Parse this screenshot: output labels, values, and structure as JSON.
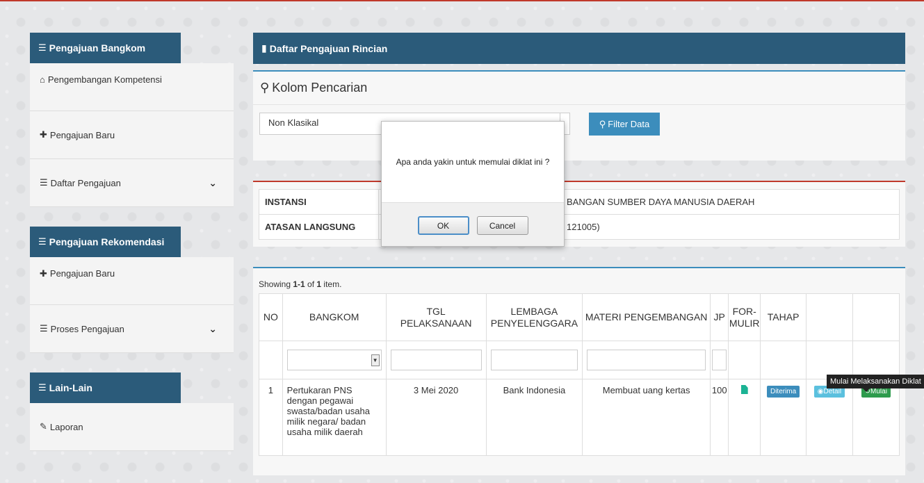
{
  "sidebar": {
    "section1": {
      "title": "Pengajuan Bangkom",
      "items": [
        {
          "label": "Pengembangan Kompetensi",
          "icon": "home-icon"
        },
        {
          "label": "Pengajuan Baru",
          "icon": "plus-icon"
        },
        {
          "label": "Daftar Pengajuan",
          "icon": "list-icon"
        }
      ]
    },
    "section2": {
      "title": "Pengajuan Rekomendasi",
      "items": [
        {
          "label": "Pengajuan Baru",
          "icon": "plus-icon"
        },
        {
          "label": "Proses Pengajuan",
          "icon": "list-icon"
        }
      ]
    },
    "section3": {
      "title": "Lain-Lain",
      "items": [
        {
          "label": "Laporan",
          "icon": "edit-icon"
        }
      ]
    }
  },
  "main": {
    "header": "Daftar Pengajuan Rincian",
    "search": {
      "title": "Kolom Pencarian",
      "select_value": "Non Klasikal",
      "filter_label": "Filter Data"
    },
    "info": {
      "instansi_label": "INSTANSI",
      "instansi_value": "BANGAN SUMBER DAYA MANUSIA DAERAH",
      "atasan_label": "ATASAN LANGSUNG",
      "atasan_value": "121005)"
    },
    "table": {
      "summary_prefix": "Showing ",
      "summary_range": "1-1",
      "summary_mid": " of ",
      "summary_total": "1",
      "summary_suffix": " item.",
      "headers": {
        "no": "NO",
        "bangkom": "BANGKOM",
        "tgl1": "TGL",
        "tgl2": "PELAKSANAAN",
        "lembaga1": "LEMBAGA",
        "lembaga2": "PENYELENGGARA",
        "materi": "MATERI PENGEMBANGAN",
        "jp": "JP",
        "formulir1": "FOR-",
        "formulir2": "MULIR",
        "tahap": "TAHAP"
      },
      "rows": [
        {
          "no": "1",
          "bangkom": "Pertukaran PNS dengan pegawai swasta/badan usaha milik negara/ badan usaha milik daerah",
          "tgl": "3 Mei 2020",
          "lembaga": "Bank Indonesia",
          "materi": "Membuat uang kertas",
          "jp": "100",
          "tahap": "Diterima",
          "detail_label": "Detail",
          "mulai_label": "Mulai"
        }
      ]
    },
    "tooltip": "Mulai Melaksanakan Diklat"
  },
  "dialog": {
    "message": "Apa anda yakin untuk memulai diklat ini ?",
    "ok": "OK",
    "cancel": "Cancel"
  }
}
